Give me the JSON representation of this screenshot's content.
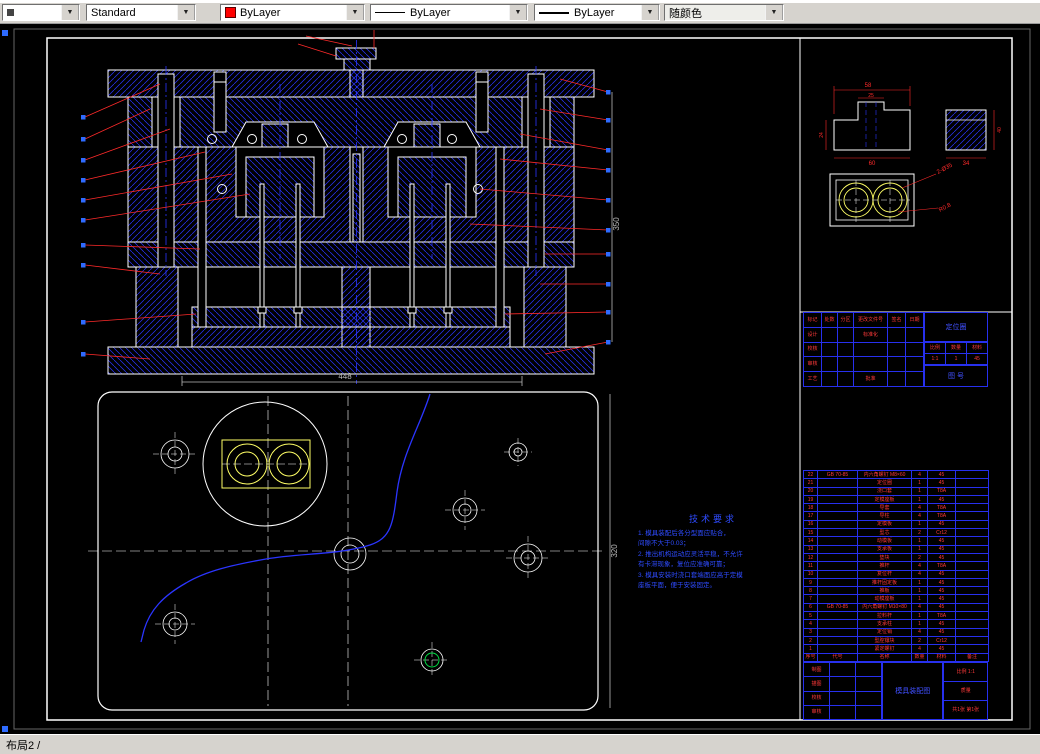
{
  "toolbar": {
    "layer_value": "",
    "style_value": "Standard",
    "color_value": "ByLayer",
    "linetype_value": "ByLayer",
    "lineweight_value": "ByLayer",
    "plotstyle_value": "随颜色"
  },
  "statusbar": {
    "layout_label": "布局2 /"
  },
  "dims": {
    "section_width": "448",
    "section_height": "350",
    "plan_height": "320",
    "detail_a_top": "58",
    "detail_a_mid": "25",
    "detail_a_left": "24",
    "detail_a_bottom": "60",
    "detail_b_right": "40",
    "detail_b_bottom": "34",
    "insert_label_1": "2-Ø35",
    "insert_label_2": "R0.8"
  },
  "tech": {
    "title": "技术要求",
    "lines": [
      "1. 模具装配后各分型面应贴合，",
      "   间隙不大于0.03；",
      "2. 推出机构运动应灵活平稳，不允许",
      "   有卡滞现象，复位应准确可靠；",
      "3. 模具安装时浇口套端面应高于定模",
      "   座板平面，便于安装固定。"
    ]
  },
  "titleblock1": {
    "left_rows": [
      [
        "标记",
        "处数",
        "分区",
        "更改文件号",
        "签名",
        "日期"
      ],
      [
        "设计",
        "",
        "",
        "标准化",
        "",
        ""
      ],
      [
        "校核",
        "",
        "",
        "",
        "",
        ""
      ],
      [
        "审核",
        "",
        "",
        "",
        "",
        ""
      ],
      [
        "工艺",
        "",
        "",
        "批准",
        "",
        ""
      ]
    ],
    "part_name": "定位圈",
    "scale_label": "比例",
    "qty_label": "数量",
    "material_label": "材料",
    "scale": "1:1",
    "qty": "1",
    "material": "45",
    "drawing_no": "图 号"
  },
  "bom": {
    "headers": [
      "序号",
      "代号",
      "名称",
      "数量",
      "材料",
      "备注"
    ],
    "rows": [
      [
        "22",
        "GB 70-85",
        "内六角螺钉 M8×60",
        "4",
        "45",
        ""
      ],
      [
        "21",
        "",
        "定位圈",
        "1",
        "45",
        ""
      ],
      [
        "20",
        "",
        "浇口套",
        "1",
        "T8A",
        ""
      ],
      [
        "19",
        "",
        "定模座板",
        "1",
        "45",
        ""
      ],
      [
        "18",
        "",
        "导套",
        "4",
        "T8A",
        ""
      ],
      [
        "17",
        "",
        "导柱",
        "4",
        "T8A",
        ""
      ],
      [
        "16",
        "",
        "定模板",
        "1",
        "45",
        ""
      ],
      [
        "15",
        "",
        "型芯",
        "2",
        "Cr12",
        ""
      ],
      [
        "14",
        "",
        "动模板",
        "1",
        "45",
        ""
      ],
      [
        "13",
        "",
        "支承板",
        "1",
        "45",
        ""
      ],
      [
        "12",
        "",
        "垫块",
        "2",
        "45",
        ""
      ],
      [
        "11",
        "",
        "推杆",
        "4",
        "T8A",
        ""
      ],
      [
        "10",
        "",
        "复位杆",
        "4",
        "45",
        ""
      ],
      [
        "9",
        "",
        "推杆固定板",
        "1",
        "45",
        ""
      ],
      [
        "8",
        "",
        "推板",
        "1",
        "45",
        ""
      ],
      [
        "7",
        "",
        "动模座板",
        "1",
        "45",
        ""
      ],
      [
        "6",
        "GB 70-85",
        "内六角螺钉 M10×80",
        "4",
        "45",
        ""
      ],
      [
        "5",
        "",
        "拉料杆",
        "1",
        "T8A",
        ""
      ],
      [
        "4",
        "",
        "支承柱",
        "1",
        "45",
        ""
      ],
      [
        "3",
        "",
        "定位销",
        "4",
        "45",
        ""
      ],
      [
        "2",
        "",
        "型腔镶块",
        "2",
        "Cr12",
        ""
      ],
      [
        "1",
        "",
        "紧定螺钉",
        "4",
        "45",
        ""
      ]
    ]
  },
  "titleblock2": {
    "left_rows": [
      [
        "制图",
        "",
        ""
      ],
      [
        "描图",
        "",
        ""
      ],
      [
        "校核",
        "",
        ""
      ],
      [
        "审核",
        "",
        ""
      ]
    ],
    "name": "模具装配图",
    "right_rows": [
      "比例 1:1",
      "质量",
      "共1张 第1张"
    ]
  }
}
